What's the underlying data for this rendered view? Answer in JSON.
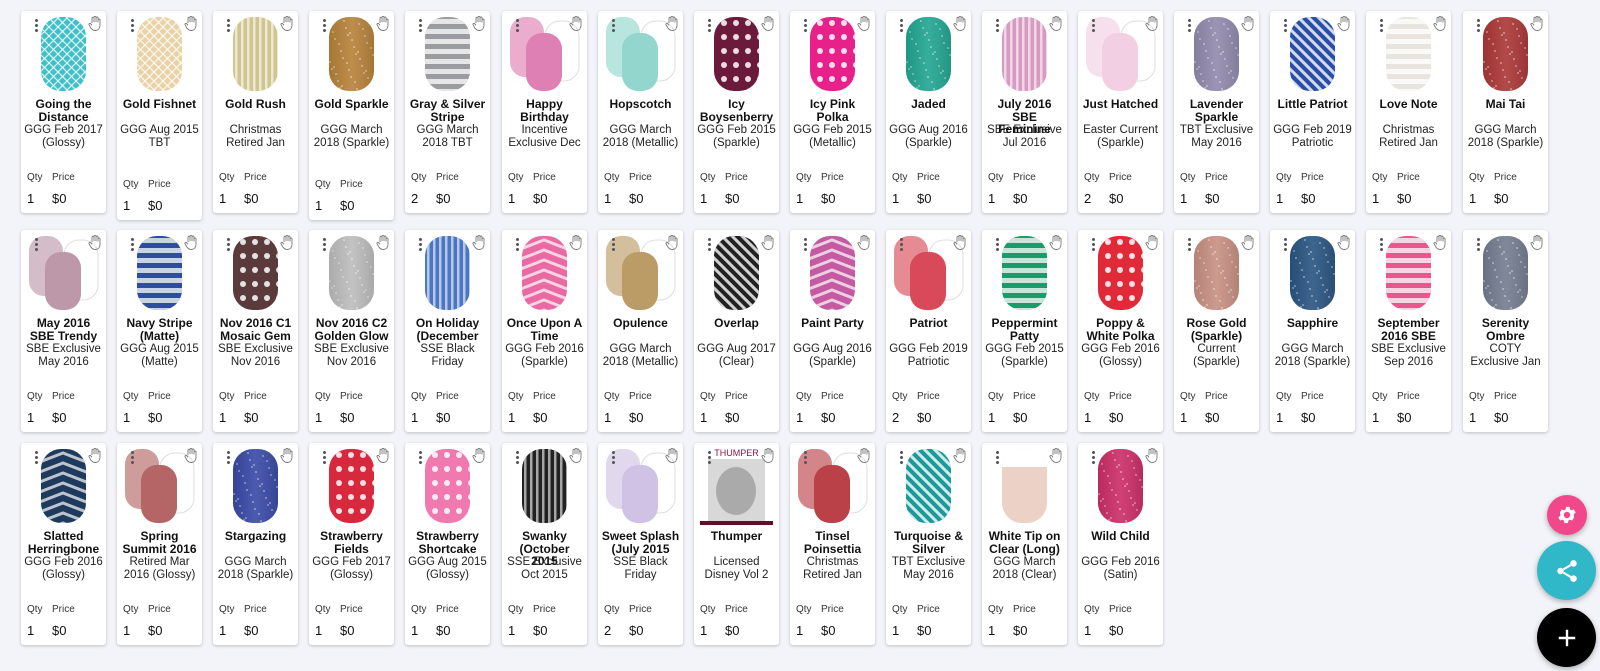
{
  "cards": [
    {
      "name": "Going the Distance",
      "desc": "GGG Feb 2017 (Glossy)",
      "qty": "1",
      "price": "$0",
      "qty_label": "Qty",
      "price_label": "Price",
      "color": "#3fc0c8",
      "pattern": "lace"
    },
    {
      "name": "Gold Fishnet",
      "desc": "GGG Aug 2015 TBT",
      "qty": "1",
      "price": "$0",
      "qty_label": "Qty",
      "price_label": "Price",
      "color": "#e8d2a6",
      "pattern": "fishnet"
    },
    {
      "name": "Gold Rush",
      "desc": "Christmas Retired Jan",
      "qty": "1",
      "price": "$0",
      "qty_label": "Qty",
      "price_label": "Price",
      "color": "#cfc58e",
      "pattern": "vstripes"
    },
    {
      "name": "Gold Sparkle",
      "desc": "GGG March 2018 (Sparkle)",
      "qty": "1",
      "price": "$0",
      "qty_label": "Qty",
      "price_label": "Price",
      "color": "#b27a2c",
      "pattern": "glitter"
    },
    {
      "name": "Gray & Silver Stripe",
      "desc": "GGG March 2018 TBT",
      "qty": "2",
      "price": "$0",
      "qty_label": "Qty",
      "price_label": "Price",
      "color": "#9a9ca0",
      "pattern": "hstripes"
    },
    {
      "name": "Happy Birthday",
      "desc": "Incentive Exclusive Dec",
      "qty": "1",
      "price": "$0",
      "qty_label": "Qty",
      "price_label": "Price",
      "color": "#d96aa6",
      "pattern": "trio"
    },
    {
      "name": "Hopscotch",
      "desc": "GGG March 2018 (Metallic)",
      "qty": "1",
      "price": "$0",
      "qty_label": "Qty",
      "price_label": "Price",
      "color": "#7fcfc5",
      "pattern": "trio"
    },
    {
      "name": "Icy Boysenberry",
      "desc": "GGG Feb 2015 (Sparkle)",
      "qty": "1",
      "price": "$0",
      "qty_label": "Qty",
      "price_label": "Price",
      "color": "#6b1a3c",
      "pattern": "dots"
    },
    {
      "name": "Icy Pink Polka",
      "desc": "GGG Feb 2015 (Metallic)",
      "qty": "1",
      "price": "$0",
      "qty_label": "Qty",
      "price_label": "Price",
      "color": "#e8208a",
      "pattern": "dots"
    },
    {
      "name": "Jaded",
      "desc": "GGG Aug 2016 (Sparkle)",
      "qty": "1",
      "price": "$0",
      "qty_label": "Qty",
      "price_label": "Price",
      "color": "#13a08a",
      "pattern": "glitter"
    },
    {
      "name": "July 2016 SBE Feminine",
      "desc": "SBE Exclusive Jul 2016",
      "qty": "1",
      "price": "$0",
      "qty_label": "Qty",
      "price_label": "Price",
      "color": "#d79bc1",
      "pattern": "vstripes"
    },
    {
      "name": "Just Hatched",
      "desc": "Easter Current (Sparkle)",
      "qty": "2",
      "price": "$0",
      "qty_label": "Qty",
      "price_label": "Price",
      "color": "#f0c7df",
      "pattern": "trio"
    },
    {
      "name": "Lavender Sparkle",
      "desc": "TBT Exclusive May 2016",
      "qty": "1",
      "price": "$0",
      "qty_label": "Qty",
      "price_label": "Price",
      "color": "#8a82a8",
      "pattern": "glitter"
    },
    {
      "name": "Little Patriot",
      "desc": "GGG Feb 2019 Patriotic",
      "qty": "1",
      "price": "$0",
      "qty_label": "Qty",
      "price_label": "Price",
      "color": "#2a4ea8",
      "pattern": "diag"
    },
    {
      "name": "Love Note",
      "desc": "Christmas Retired Jan",
      "qty": "1",
      "price": "$0",
      "qty_label": "Qty",
      "price_label": "Price",
      "color": "#e8e5de",
      "pattern": "hstripes"
    },
    {
      "name": "Mai Tai",
      "desc": "GGG March 2018 (Sparkle)",
      "qty": "1",
      "price": "$0",
      "qty_label": "Qty",
      "price_label": "Price",
      "color": "#a62a2a",
      "pattern": "glitter"
    },
    {
      "name": "May 2016 SBE Trendy",
      "desc": "SBE Exclusive May 2016",
      "qty": "1",
      "price": "$0",
      "qty_label": "Qty",
      "price_label": "Price",
      "color": "#b1879a",
      "pattern": "trio"
    },
    {
      "name": "Navy Stripe (Matte)",
      "desc": "GGG Aug 2015 (Matte)",
      "qty": "1",
      "price": "$0",
      "qty_label": "Qty",
      "price_label": "Price",
      "color": "#2c4da0",
      "pattern": "hstripes"
    },
    {
      "name": "Nov 2016 C1 Mosaic Gem",
      "desc": "SBE Exclusive Nov 2016",
      "qty": "1",
      "price": "$0",
      "qty_label": "Qty",
      "price_label": "Price",
      "color": "#5a3a3a",
      "pattern": "dots"
    },
    {
      "name": "Nov 2016 C2 Golden Glow",
      "desc": "SBE Exclusive Nov 2016",
      "qty": "1",
      "price": "$0",
      "qty_label": "Qty",
      "price_label": "Price",
      "color": "#b8b8b8",
      "pattern": "glitter"
    },
    {
      "name": "On Holiday (December",
      "desc": "SSE Black Friday",
      "qty": "1",
      "price": "$0",
      "qty_label": "Qty",
      "price_label": "Price",
      "color": "#4a76c2",
      "pattern": "vstripes"
    },
    {
      "name": "Once Upon A Time",
      "desc": "GGG Feb 2016 (Sparkle)",
      "qty": "1",
      "price": "$0",
      "qty_label": "Qty",
      "price_label": "Price",
      "color": "#e96aa3",
      "pattern": "chevron"
    },
    {
      "name": "Opulence",
      "desc": "GGG March 2018 (Metallic)",
      "qty": "1",
      "price": "$0",
      "qty_label": "Qty",
      "price_label": "Price",
      "color": "#b08a4c",
      "pattern": "trio"
    },
    {
      "name": "Overlap",
      "desc": "GGG Aug 2017 (Clear)",
      "qty": "1",
      "price": "$0",
      "qty_label": "Qty",
      "price_label": "Price",
      "color": "#222222",
      "pattern": "diag"
    },
    {
      "name": "Paint Party",
      "desc": "GGG Aug 2016 (Sparkle)",
      "qty": "1",
      "price": "$0",
      "qty_label": "Qty",
      "price_label": "Price",
      "color": "#c45aa0",
      "pattern": "chevron"
    },
    {
      "name": "Patriot",
      "desc": "GGG Feb 2019 Patriotic",
      "qty": "2",
      "price": "$0",
      "qty_label": "Qty",
      "price_label": "Price",
      "color": "#d22a3c",
      "pattern": "trio"
    },
    {
      "name": "Peppermint Patty",
      "desc": "GGG Feb 2015 (Sparkle)",
      "qty": "1",
      "price": "$0",
      "qty_label": "Qty",
      "price_label": "Price",
      "color": "#1a9c6a",
      "pattern": "hstripes"
    },
    {
      "name": "Poppy & White Polka",
      "desc": "GGG Feb 2016 (Glossy)",
      "qty": "1",
      "price": "$0",
      "qty_label": "Qty",
      "price_label": "Price",
      "color": "#e02a3a",
      "pattern": "dots"
    },
    {
      "name": "Rose Gold (Sparkle)",
      "desc": "Current (Sparkle)",
      "qty": "1",
      "price": "$0",
      "qty_label": "Qty",
      "price_label": "Price",
      "color": "#c4887a",
      "pattern": "glitter"
    },
    {
      "name": "Sapphire",
      "desc": "GGG March 2018 (Sparkle)",
      "qty": "1",
      "price": "$0",
      "qty_label": "Qty",
      "price_label": "Price",
      "color": "#1c4a7a",
      "pattern": "glitter"
    },
    {
      "name": "September 2016 SBE",
      "desc": "SBE Exclusive Sep 2016",
      "qty": "1",
      "price": "$0",
      "qty_label": "Qty",
      "price_label": "Price",
      "color": "#e8588e",
      "pattern": "hstripes"
    },
    {
      "name": "Serenity Ombre",
      "desc": "COTY Exclusive Jan",
      "qty": "1",
      "price": "$0",
      "qty_label": "Qty",
      "price_label": "Price",
      "color": "#6a7488",
      "pattern": "glitter"
    },
    {
      "name": "Slatted Herringbone",
      "desc": "GGG Feb 2016 (Glossy)",
      "qty": "1",
      "price": "$0",
      "qty_label": "Qty",
      "price_label": "Price",
      "color": "#1e3a5c",
      "pattern": "chevron"
    },
    {
      "name": "Spring Summit 2016",
      "desc": "Retired Mar 2016 (Glossy)",
      "qty": "1",
      "price": "$0",
      "qty_label": "Qty",
      "price_label": "Price",
      "color": "#a84a4a",
      "pattern": "trio"
    },
    {
      "name": "Stargazing",
      "desc": "GGG March 2018 (Sparkle)",
      "qty": "1",
      "price": "$0",
      "qty_label": "Qty",
      "price_label": "Price",
      "color": "#2c3ea0",
      "pattern": "glitter"
    },
    {
      "name": "Strawberry Fields",
      "desc": "GGG Feb 2017 (Glossy)",
      "qty": "1",
      "price": "$0",
      "qty_label": "Qty",
      "price_label": "Price",
      "color": "#d8283e",
      "pattern": "dots"
    },
    {
      "name": "Strawberry Shortcake",
      "desc": "GGG Aug 2015 (Glossy)",
      "qty": "1",
      "price": "$0",
      "qty_label": "Qty",
      "price_label": "Price",
      "color": "#f07ab0",
      "pattern": "dots"
    },
    {
      "name": "Swanky (October 2015",
      "desc": "SSE Exclusive Oct 2015",
      "qty": "1",
      "price": "$0",
      "qty_label": "Qty",
      "price_label": "Price",
      "color": "#222222",
      "pattern": "vstripes"
    },
    {
      "name": "Sweet Splash (July 2015",
      "desc": "SSE Black Friday",
      "qty": "2",
      "price": "$0",
      "qty_label": "Qty",
      "price_label": "Price",
      "color": "#c8b8e0",
      "pattern": "trio"
    },
    {
      "name": "Thumper",
      "desc": "Licensed Disney Vol 2",
      "qty": "1",
      "price": "$0",
      "qty_label": "Qty",
      "price_label": "Price",
      "color": "#cccccc",
      "pattern": "poster",
      "brand_text": "THUMPER"
    },
    {
      "name": "Tinsel Poinsettia",
      "desc": "Christmas Retired Jan",
      "qty": "1",
      "price": "$0",
      "qty_label": "Qty",
      "price_label": "Price",
      "color": "#b0202a",
      "pattern": "trio"
    },
    {
      "name": "Turquoise & Silver",
      "desc": "TBT Exclusive May 2016",
      "qty": "1",
      "price": "$0",
      "qty_label": "Qty",
      "price_label": "Price",
      "color": "#1a9a9a",
      "pattern": "diag"
    },
    {
      "name": "White Tip on Clear (Long)",
      "desc": "GGG March 2018 (Clear)",
      "qty": "1",
      "price": "$0",
      "qty_label": "Qty",
      "price_label": "Price",
      "color": "#ecd2c6",
      "pattern": "tip"
    },
    {
      "name": "Wild Child",
      "desc": "GGG Feb 2016 (Satin)",
      "qty": "1",
      "price": "$0",
      "qty_label": "Qty",
      "price_label": "Price",
      "color": "#c8205e",
      "pattern": "glitter"
    }
  ],
  "fabs": {
    "settings_color": "#f0488a",
    "share_color": "#30b8c8",
    "add_color": "#000000"
  }
}
